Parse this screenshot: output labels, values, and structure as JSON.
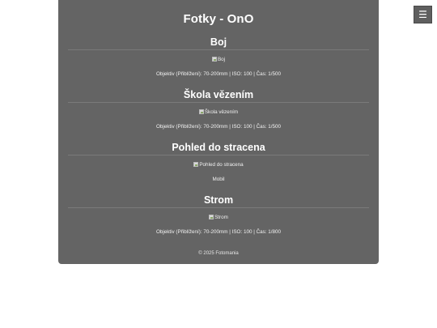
{
  "site": {
    "title": "Fotky - OnO"
  },
  "menu": {
    "icon": "☰",
    "icon_name": "hamburger-menu-icon"
  },
  "sections": [
    {
      "heading": "Boj",
      "image_alt": "Boj",
      "meta": "Objektiv (Přiblížení): 70-200mm | ISO: 100 | Čas: 1/500"
    },
    {
      "heading": "Škola vězením",
      "image_alt": "Škola vězením",
      "meta": "Objektiv (Přiblížení): 70-200mm | ISO: 100 | Čas: 1/500"
    },
    {
      "heading": "Pohled do stracena",
      "image_alt": "Pohled do stracena",
      "meta": "Mobil"
    },
    {
      "heading": "Strom",
      "image_alt": "Strom",
      "meta": "Objektiv (Přiblížení): 70-200mm | ISO: 100 | Čas: 1/800"
    }
  ],
  "footer": {
    "text": "© 2025 Fotomania"
  },
  "colors": {
    "panel_background": "#646464",
    "page_background": "#ffffff",
    "text": "#ffffff"
  }
}
